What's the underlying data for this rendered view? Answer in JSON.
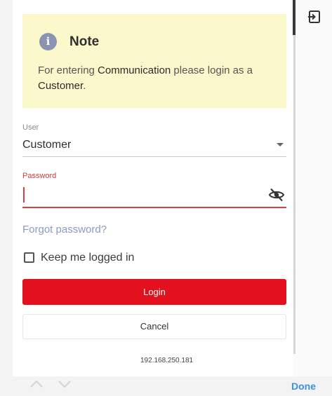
{
  "note": {
    "title": "Note",
    "body_prefix": "For entering ",
    "body_highlight": "Communication",
    "body_suffix": " please login as a ",
    "body_highlight2": "Customer",
    "body_end": "."
  },
  "user": {
    "label": "User",
    "value": "Customer"
  },
  "password": {
    "label": "Password",
    "value": ""
  },
  "forgot_password": "Forgot password?",
  "keep_logged_in": {
    "label": "Keep me logged in",
    "checked": false
  },
  "buttons": {
    "login": "Login",
    "cancel": "Cancel"
  },
  "ip_address": "192.168.250.181",
  "keyboard_bar": {
    "done": "Done"
  },
  "colors": {
    "accent_red": "#e3101e",
    "note_bg": "#fbf8cc",
    "link": "#8b9bc0",
    "done_blue": "#3d8fe0"
  },
  "icons": {
    "note": "info-icon",
    "panel": "logout-icon",
    "password_toggle": "eye-off-icon",
    "prev": "chevron-up-icon",
    "next": "chevron-down-icon"
  }
}
